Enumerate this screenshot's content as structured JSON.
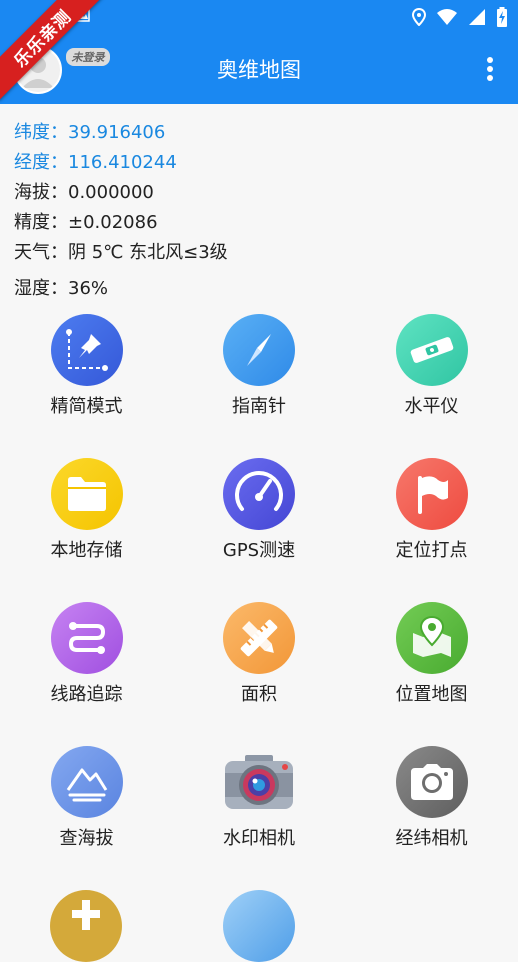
{
  "header": {
    "title": "奥维地图",
    "login_badge": "未登录",
    "ribbon": "乐乐亲测"
  },
  "info": {
    "latitude": "纬度：39.916406",
    "longitude": "经度：116.410244",
    "altitude": "海拔：0.000000",
    "accuracy": "精度：±0.02086",
    "weather": "天气：阴  5℃  东北风≤3级",
    "humidity": "湿度：36%"
  },
  "tools": [
    {
      "label": "精简模式",
      "icon": "simple-mode-icon",
      "color": "#3f6ee8"
    },
    {
      "label": "指南针",
      "icon": "compass-icon",
      "color": "#3d9bf0"
    },
    {
      "label": "水平仪",
      "icon": "level-icon",
      "color": "#45d6b4"
    },
    {
      "label": "本地存储",
      "icon": "folder-icon",
      "color": "#f8cf11"
    },
    {
      "label": "GPS测速",
      "icon": "speedometer-icon",
      "color": "#5a5be3"
    },
    {
      "label": "定位打点",
      "icon": "flag-icon",
      "color": "#f25e52"
    },
    {
      "label": "线路追踪",
      "icon": "route-icon",
      "color": "#b363e8"
    },
    {
      "label": "面积",
      "icon": "ruler-pencil-icon",
      "color": "#f7a452"
    },
    {
      "label": "位置地图",
      "icon": "map-pin-icon",
      "color": "#5fc043"
    },
    {
      "label": "查海拔",
      "icon": "mountain-icon",
      "color": "#6e96e8"
    },
    {
      "label": "水印相机",
      "icon": "camera-color-icon",
      "color": "#9aa3b2"
    },
    {
      "label": "经纬相机",
      "icon": "camera-icon",
      "color": "#7a7a7a"
    }
  ]
}
